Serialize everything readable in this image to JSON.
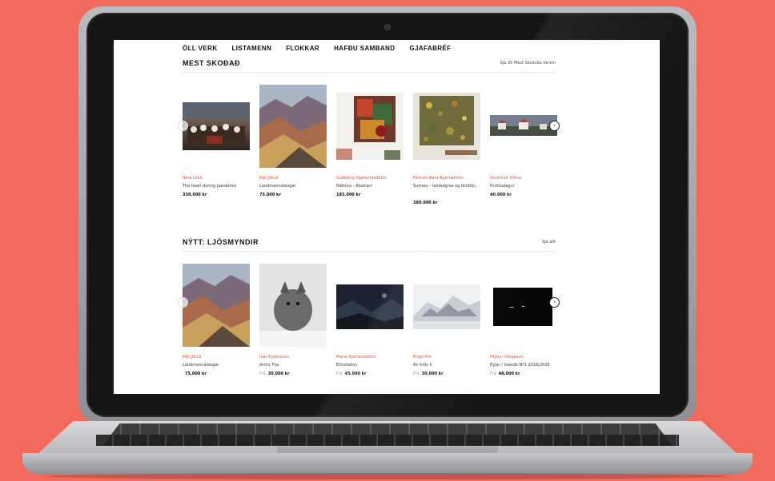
{
  "nav": {
    "items": [
      "ÖLL VERK",
      "LISTAMENN",
      "FLOKKAR",
      "HAFÐU SAMBAND",
      "GJAFABRÉF"
    ]
  },
  "sections": [
    {
      "title": "MEST SKOÐAÐ",
      "link": "Sjá 30 Mest Skoðuðu Verkin",
      "products": [
        {
          "artist": "Nína Lovíí",
          "title": "The feast during pandemic",
          "price": "330.000 kr"
        },
        {
          "artist": "Páll Jökull",
          "title": "Landmannalaugar",
          "price": "75.000 kr"
        },
        {
          "artist": "Guðbjörg Sigmundsdóttir",
          "title": "Náttúra - Abstract",
          "price": "185.000 kr"
        },
        {
          "artist": "Hörunn Bára Bjarnadóttir",
          "title": "Surtsey - lambagras og blóðbju",
          "price": "380.000 kr"
        },
        {
          "artist": "Vesinholt Hilma",
          "title": "Þvottadagur",
          "price": "40.000 kr"
        }
      ]
    },
    {
      "title": "NÝTT: LJÓSMYNDIR",
      "link": "Sjá allt",
      "products": [
        {
          "artist": "Páll Jökull",
          "title": "Landmannalaugar",
          "price_prefix": "",
          "price": "75.000 kr"
        },
        {
          "artist": "Ívar Eyþórsson",
          "title": "Arctic Fox",
          "price_prefix": "Frá",
          "price": "30.000 kr"
        },
        {
          "artist": "María Kjartansdóttir",
          "title": "Elmstaðon",
          "price_prefix": "Frá",
          "price": "45.000 kr"
        },
        {
          "artist": "Bragi Þór",
          "title": "Án titils II",
          "price_prefix": "Frá",
          "price": "30.000 kr"
        },
        {
          "artist": "Hlynur Helgason",
          "title": "Eyjar / Islands Nº1 2018/2020",
          "price_prefix": "Frá",
          "price": "48.000 kr"
        }
      ]
    }
  ],
  "arrows": {
    "prev": "‹",
    "next": "›"
  },
  "colors": {
    "accent": "#e9463c",
    "background": "#f1695c"
  }
}
